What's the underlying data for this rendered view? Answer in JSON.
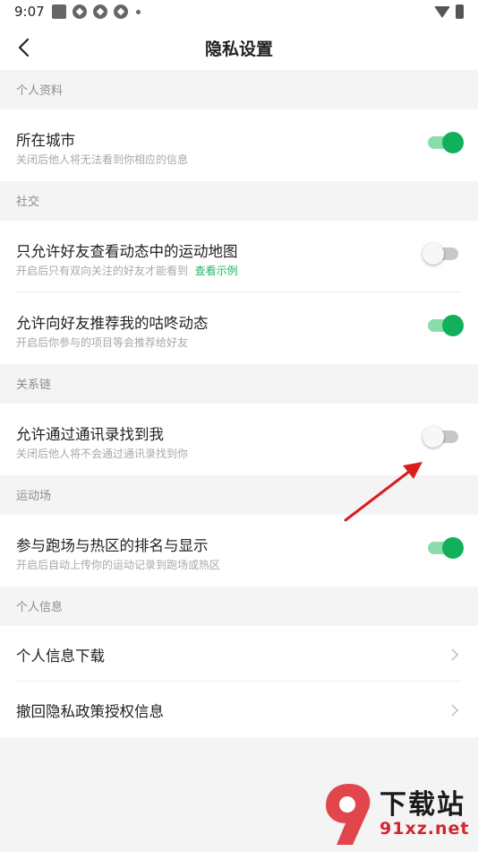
{
  "status_bar": {
    "time": "9:07"
  },
  "header": {
    "title": "隐私设置"
  },
  "sections": [
    {
      "label": "个人资料",
      "rows": [
        {
          "title": "所在城市",
          "subtitle": "关闭后他人将无法看到你相应的信息",
          "toggle": "on"
        }
      ]
    },
    {
      "label": "社交",
      "rows": [
        {
          "title": "只允许好友查看动态中的运动地图",
          "subtitle": "开启后只有双向关注的好友才能看到",
          "link": "查看示例",
          "toggle": "off"
        },
        {
          "title": "允许向好友推荐我的咕咚动态",
          "subtitle": "开启后你参与的项目等会推荐给好友",
          "toggle": "on"
        }
      ]
    },
    {
      "label": "关系链",
      "rows": [
        {
          "title": "允许通过通讯录找到我",
          "subtitle": "关闭后他人将不会通过通讯录找到你",
          "toggle": "off"
        }
      ]
    },
    {
      "label": "运动场",
      "rows": [
        {
          "title": "参与跑场与热区的排名与显示",
          "subtitle": "开启后自动上传你的运动记录到跑场或热区",
          "toggle": "on"
        }
      ]
    },
    {
      "label": "个人信息",
      "rows": [
        {
          "title": "个人信息下载"
        },
        {
          "title": "撤回隐私政策授权信息"
        }
      ]
    }
  ],
  "watermark": {
    "text": "下载站",
    "url": "91xz.net"
  },
  "colors": {
    "accent": "#12b05a",
    "toggle_track_on": "#8adcab",
    "annotation_arrow": "#d81e1e"
  }
}
